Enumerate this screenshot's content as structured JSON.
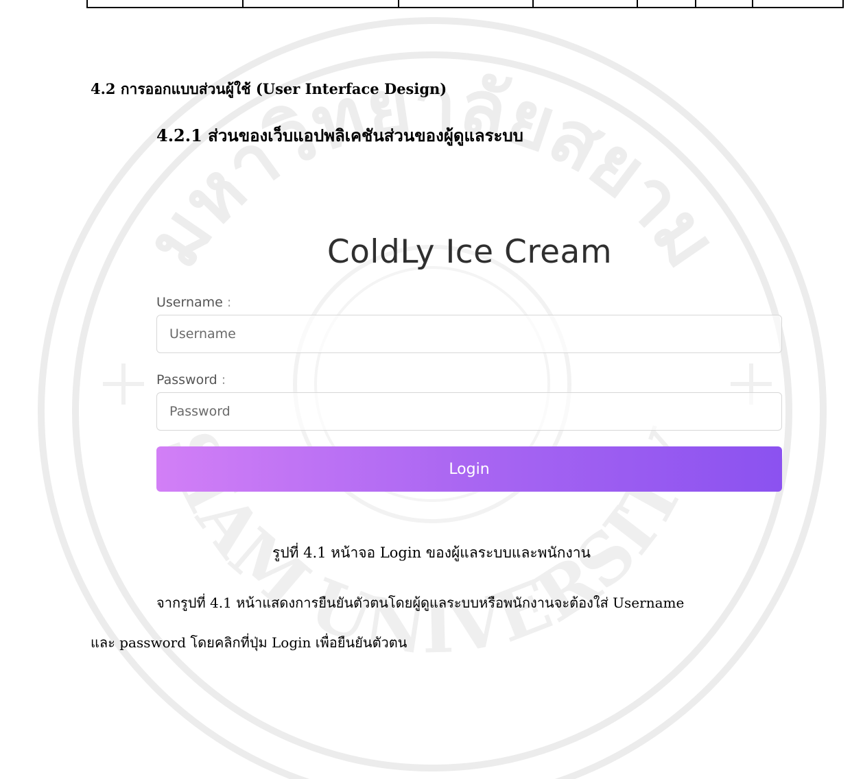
{
  "section_heading": "4.2 การออกแบบส่วนผู้ใช้ (User Interface Design)",
  "subsection_heading": "4.2.1 ส่วนของเว็บแอปพลิเคชันส่วนของผู้ดูแลระบบ",
  "login_form": {
    "app_title": "ColdLy Ice Cream",
    "username_label": "Username",
    "username_placeholder": "Username",
    "password_label": "Password",
    "password_placeholder": "Password",
    "label_colon": ":",
    "login_button": "Login",
    "button_gradient": [
      "#d27ff6",
      "#8b52f0"
    ]
  },
  "figure_caption": "รูปที่ 4.1 หน้าจอ Login ของผู้แลระบบและพนักงาน",
  "paragraph": {
    "line1": "จากรูปที่ 4.1 หน้าแสดงการยืนยันตัวตนโดยผู้ดูแลระบบหรือพนักงานจะต้องใส่ Username",
    "line2": "และ password โดยคลิกที่ปุ่ม Login เพื่อยืนยันตัวตน"
  },
  "watermark": {
    "text_top": "มหาวิทยาลัยสยาม",
    "text_bottom": "SIAM UNIVERSITY"
  }
}
